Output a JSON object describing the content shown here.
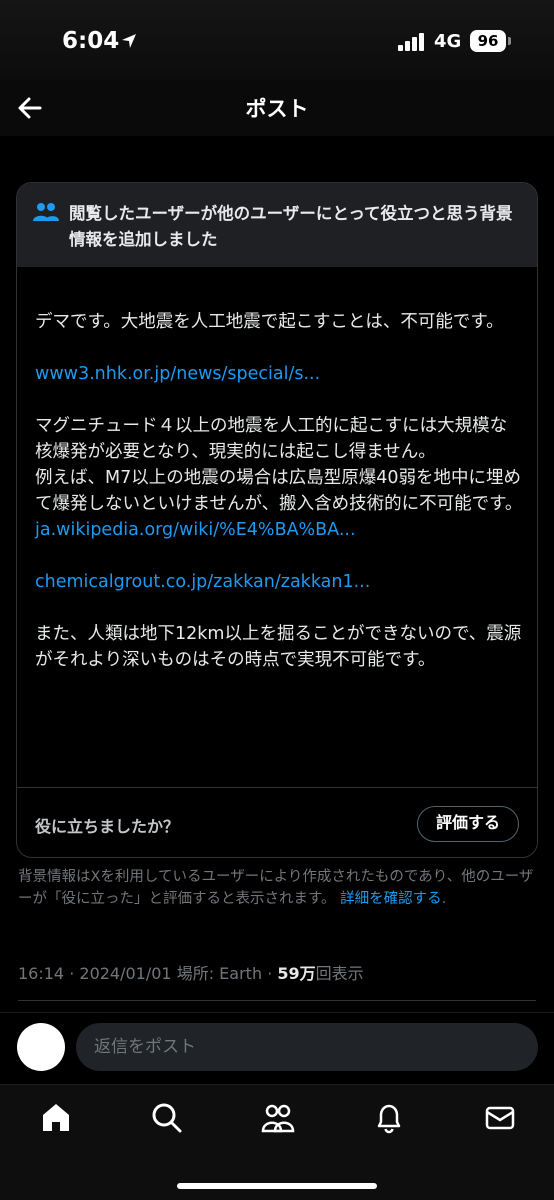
{
  "status_bar": {
    "time": "6:04",
    "network": "4G",
    "battery": "96"
  },
  "header": {
    "title": "ポスト",
    "back_icon": "arrow-left-icon"
  },
  "note": {
    "heading": "閲覧したユーザーが他のユーザーにとって役立つと思う背景情報を追加しました",
    "paragraphs": [
      "デマです。大地震を人工地震で起こすことは、不可能です。",
      "www3.nhk.or.jp/news/special/s...",
      "マグニチュード４以上の地震を人工的に起こすには大規模な核爆発が必要となり、現実的には起こし得ません。",
      "例えば、M7以上の地震の場合は広島型原爆40弱を地中に埋めて爆発しないといけませんが、搬入含め技術的に不可能です。",
      "ja.wikipedia.org/wiki/%E4%BA%BA...",
      "chemicalgrout.co.jp/zakkan/zakkan1...",
      "また、人類は地下12km以上を掘ることができないので、震源がそれより深いものはその時点で実現不可能です。"
    ],
    "helpful_question": "役に立ちましたか？",
    "rate_button": "評価する"
  },
  "disclaimer": {
    "text": "背景情報はXを利用しているユーザーにより作成されたものであり、他のユーザーが「役に立った」と評価すると表示されます。",
    "link": "詳細を確認する",
    "end": "."
  },
  "meta": {
    "time": "16:14",
    "date": "2024/01/01",
    "location_label": "場所: Earth",
    "views_count": "59万",
    "views_suffix": "回表示",
    "sep": "·"
  },
  "reply": {
    "placeholder": "返信をポスト"
  },
  "colors": {
    "accent": "#1d9bf0",
    "background": "#000000",
    "card_header": "#1e2024",
    "muted": "#71767b"
  },
  "nav_icons": [
    "home-icon",
    "search-icon",
    "communities-icon",
    "notifications-icon",
    "messages-icon"
  ]
}
